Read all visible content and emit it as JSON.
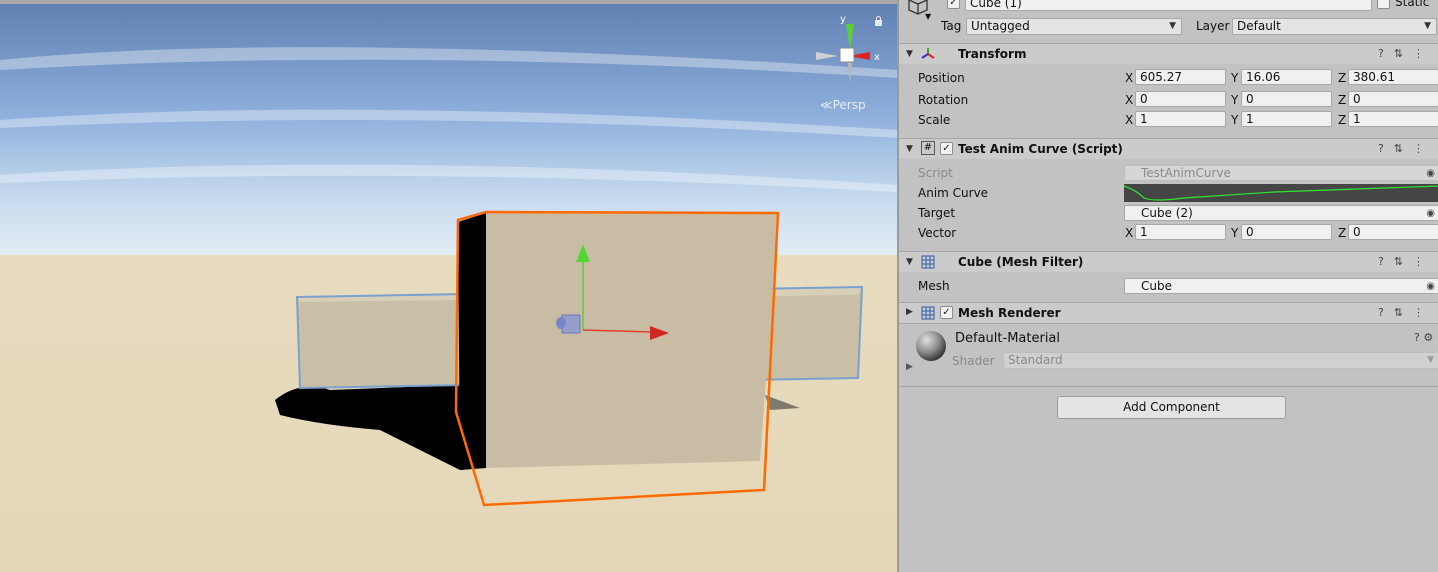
{
  "scene": {
    "persp_label": "Persp",
    "gizmo_axes": {
      "y": "y",
      "x": "x"
    },
    "icons": [
      "lock-icon",
      "scene-gizmo-icon",
      "move-tool-icon"
    ]
  },
  "inspector": {
    "object_name": "Cube (1)",
    "static_label": "Static",
    "tag_label": "Tag",
    "tag_value": "Untagged",
    "layer_label": "Layer",
    "layer_value": "Default",
    "transform": {
      "title": "Transform",
      "rows": [
        {
          "label": "Position",
          "x": "605.27",
          "y": "16.06",
          "z": "380.61"
        },
        {
          "label": "Rotation",
          "x": "0",
          "y": "0",
          "z": "0"
        },
        {
          "label": "Scale",
          "x": "1",
          "y": "1",
          "z": "1"
        }
      ]
    },
    "script_component": {
      "title": "Test Anim Curve (Script)",
      "script_label": "Script",
      "script_value": "TestAnimCurve",
      "curve_label": "Anim Curve",
      "target_label": "Target",
      "target_value": "Cube (2)",
      "vector_label": "Vector",
      "vector": {
        "x": "1",
        "y": "0",
        "z": "0"
      }
    },
    "mesh_filter": {
      "title": "Cube (Mesh Filter)",
      "mesh_label": "Mesh",
      "mesh_value": "Cube"
    },
    "mesh_renderer": {
      "title": "Mesh Renderer"
    },
    "material": {
      "name": "Default-Material",
      "shader_label": "Shader",
      "shader_value": "Standard"
    },
    "add_component_label": "Add Component",
    "axis_labels": {
      "x": "X",
      "y": "Y",
      "z": "Z"
    }
  },
  "colors": {
    "selection_outline": "#ff6a00",
    "child_outline": "#7aa0d0",
    "curve": "#2ee62e",
    "ground": "#e6d8b8"
  }
}
